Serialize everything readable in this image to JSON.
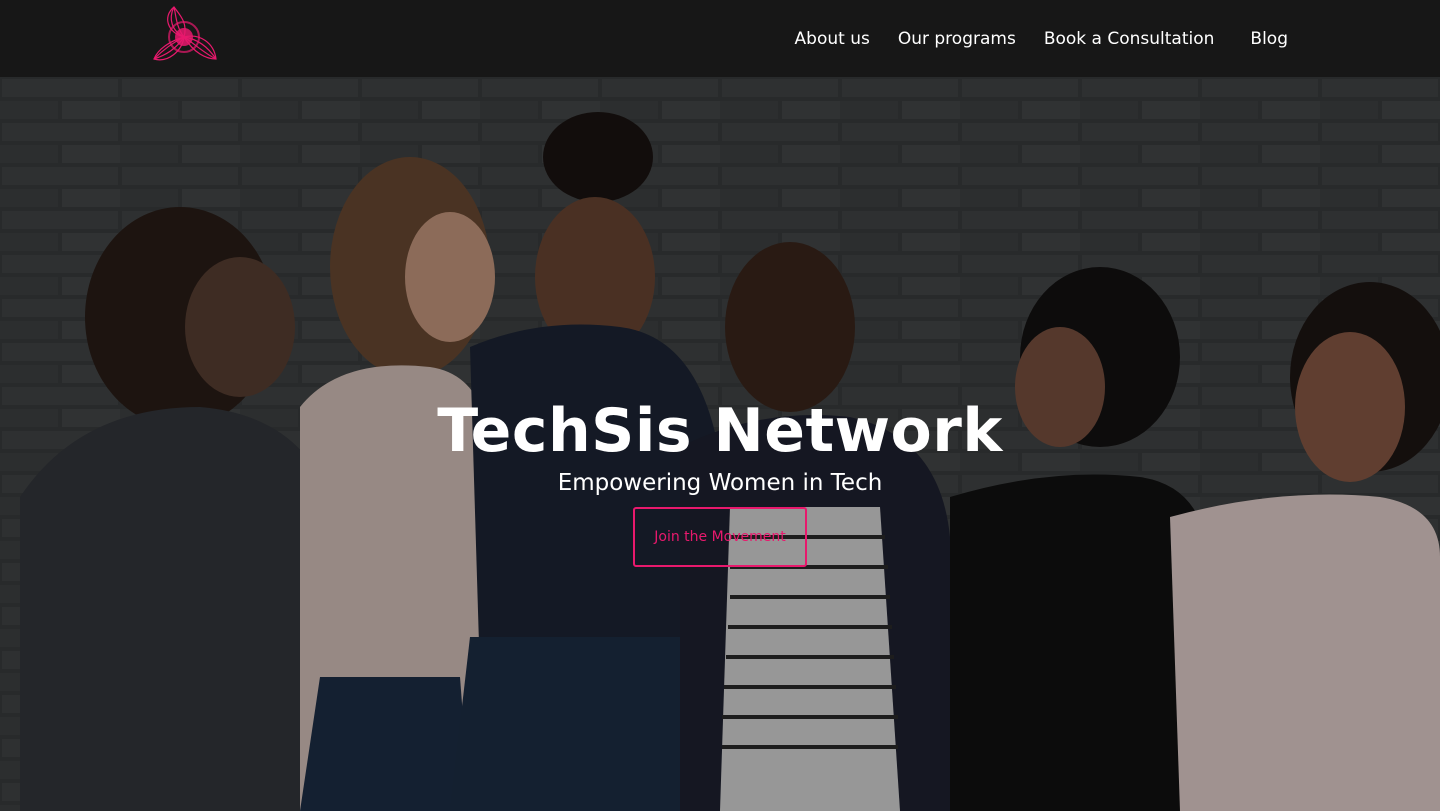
{
  "brand": {
    "logo_icon": "techsis-swirl-logo",
    "accent_color": "#e8196d"
  },
  "nav": {
    "items": [
      {
        "label": "About us"
      },
      {
        "label": "Our programs"
      },
      {
        "label": "Book a Consultation"
      },
      {
        "label": "Blog"
      }
    ]
  },
  "hero": {
    "title": "TechSis Network",
    "subtitle": "Empowering Women in Tech",
    "cta_label": "Join the Movement",
    "background_image": "group-of-smiling-women-photo"
  }
}
